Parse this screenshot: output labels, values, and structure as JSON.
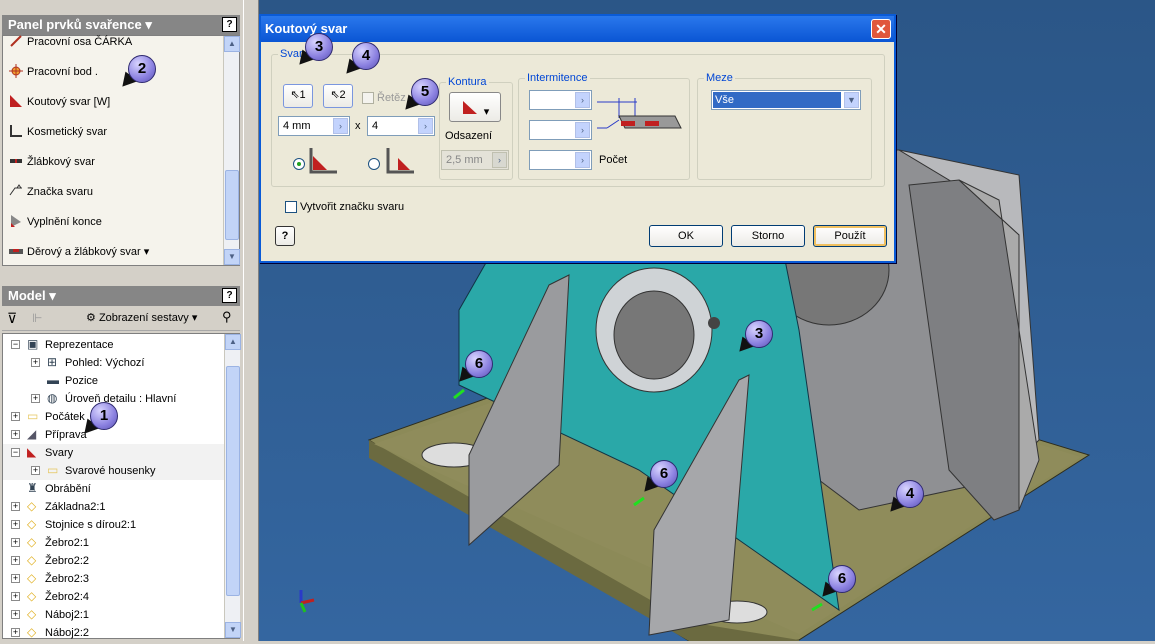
{
  "weld_panel": {
    "title": "Panel prvků svařence",
    "help": "?",
    "items": [
      {
        "label": "Pracovní osa    ČÁRKA",
        "icon": "work-axis-icon"
      },
      {
        "label": "Pracovní bod     .",
        "icon": "work-point-icon"
      },
      {
        "label": "Koutový svar    [W]",
        "icon": "fillet-weld-icon"
      },
      {
        "label": "Kosmetický svar",
        "icon": "cosmetic-weld-icon"
      },
      {
        "label": "Žlábkový svar",
        "icon": "groove-weld-icon"
      },
      {
        "label": "Značka svaru",
        "icon": "weld-symbol-icon"
      },
      {
        "label": "Vyplnění konce",
        "icon": "end-fill-icon"
      },
      {
        "label": "Děrový a žlábkový svar",
        "icon": "plug-slot-weld-icon"
      }
    ]
  },
  "model_panel": {
    "title": "Model",
    "help": "?",
    "toolbar_view": "Zobrazení sestavy",
    "tree": [
      {
        "label": "Reprezentace",
        "level": 0,
        "expand": "−",
        "icon": "representation-icon"
      },
      {
        "label": "Pohled: Výchozí",
        "level": 1,
        "expand": "+",
        "icon": "view-icon"
      },
      {
        "label": "Pozice",
        "level": 1,
        "expand": "",
        "icon": "position-icon"
      },
      {
        "label": "Úroveň detailu : Hlavní",
        "level": 1,
        "expand": "+",
        "icon": "lod-icon"
      },
      {
        "label": "Počátek",
        "level": 0,
        "expand": "+",
        "icon": "folder-icon"
      },
      {
        "label": "Příprava",
        "level": 0,
        "expand": "+",
        "icon": "preparation-icon"
      },
      {
        "label": "Svary",
        "level": 0,
        "expand": "−",
        "icon": "welds-icon"
      },
      {
        "label": "Svarové housenky",
        "level": 1,
        "expand": "+",
        "icon": "folder-icon"
      },
      {
        "label": "Obrábění",
        "level": 0,
        "expand": "",
        "icon": "machining-icon"
      },
      {
        "label": "Základna2:1",
        "level": 0,
        "expand": "+",
        "icon": "part-icon"
      },
      {
        "label": "Stojnice s dírou2:1",
        "level": 0,
        "expand": "+",
        "icon": "part-icon"
      },
      {
        "label": "Žebro2:1",
        "level": 0,
        "expand": "+",
        "icon": "part-icon"
      },
      {
        "label": "Žebro2:2",
        "level": 0,
        "expand": "+",
        "icon": "part-icon"
      },
      {
        "label": "Žebro2:3",
        "level": 0,
        "expand": "+",
        "icon": "part-icon"
      },
      {
        "label": "Žebro2:4",
        "level": 0,
        "expand": "+",
        "icon": "part-icon"
      },
      {
        "label": "Náboj2:1",
        "level": 0,
        "expand": "+",
        "icon": "part-icon"
      },
      {
        "label": "Náboj2:2",
        "level": 0,
        "expand": "+",
        "icon": "part-icon"
      }
    ]
  },
  "dialog": {
    "title": "Koutový svar",
    "close": "✕",
    "svar_group": "Svar",
    "sel1": "1",
    "sel2": "2",
    "chain": "Řetěz",
    "size": "4 mm",
    "times": "x",
    "leg": "4",
    "kontura": "Kontura",
    "odsazeni": "Odsazení",
    "offset": "2,5 mm",
    "intermittence": "Intermitence",
    "pocet": "Počet",
    "meze": "Meze",
    "meze_value": "Vše",
    "create_symbol": "Vytvořit značku svaru",
    "ok": "OK",
    "cancel": "Storno",
    "apply": "Použít",
    "help": "?"
  },
  "callouts": [
    "1",
    "2",
    "3",
    "4",
    "5",
    "3",
    "4",
    "6",
    "6",
    "6"
  ],
  "colors": {
    "viewport": "#2d5a8e",
    "face_teal": "#2aa8a8",
    "plate": "#8c8a58",
    "part_gray": "#8f9093"
  }
}
